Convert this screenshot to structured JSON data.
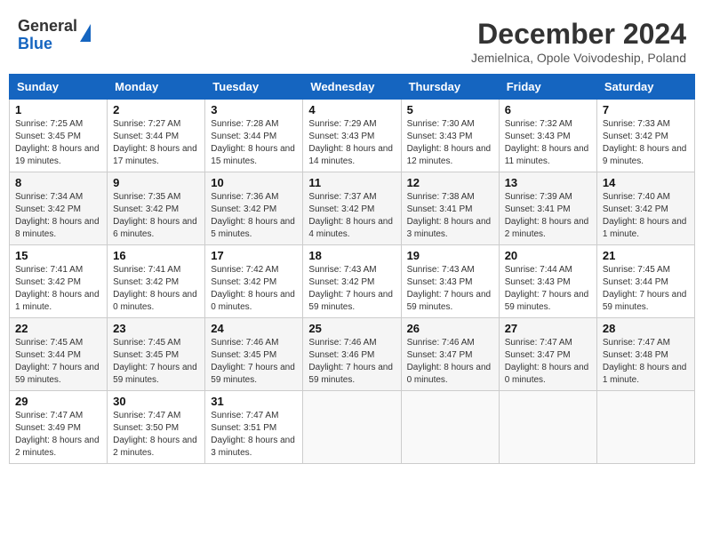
{
  "logo": {
    "general": "General",
    "blue": "Blue"
  },
  "title": "December 2024",
  "subtitle": "Jemielnica, Opole Voivodeship, Poland",
  "days_of_week": [
    "Sunday",
    "Monday",
    "Tuesday",
    "Wednesday",
    "Thursday",
    "Friday",
    "Saturday"
  ],
  "weeks": [
    [
      {
        "day": "1",
        "sunrise": "Sunrise: 7:25 AM",
        "sunset": "Sunset: 3:45 PM",
        "daylight": "Daylight: 8 hours and 19 minutes."
      },
      {
        "day": "2",
        "sunrise": "Sunrise: 7:27 AM",
        "sunset": "Sunset: 3:44 PM",
        "daylight": "Daylight: 8 hours and 17 minutes."
      },
      {
        "day": "3",
        "sunrise": "Sunrise: 7:28 AM",
        "sunset": "Sunset: 3:44 PM",
        "daylight": "Daylight: 8 hours and 15 minutes."
      },
      {
        "day": "4",
        "sunrise": "Sunrise: 7:29 AM",
        "sunset": "Sunset: 3:43 PM",
        "daylight": "Daylight: 8 hours and 14 minutes."
      },
      {
        "day": "5",
        "sunrise": "Sunrise: 7:30 AM",
        "sunset": "Sunset: 3:43 PM",
        "daylight": "Daylight: 8 hours and 12 minutes."
      },
      {
        "day": "6",
        "sunrise": "Sunrise: 7:32 AM",
        "sunset": "Sunset: 3:43 PM",
        "daylight": "Daylight: 8 hours and 11 minutes."
      },
      {
        "day": "7",
        "sunrise": "Sunrise: 7:33 AM",
        "sunset": "Sunset: 3:42 PM",
        "daylight": "Daylight: 8 hours and 9 minutes."
      }
    ],
    [
      {
        "day": "8",
        "sunrise": "Sunrise: 7:34 AM",
        "sunset": "Sunset: 3:42 PM",
        "daylight": "Daylight: 8 hours and 8 minutes."
      },
      {
        "day": "9",
        "sunrise": "Sunrise: 7:35 AM",
        "sunset": "Sunset: 3:42 PM",
        "daylight": "Daylight: 8 hours and 6 minutes."
      },
      {
        "day": "10",
        "sunrise": "Sunrise: 7:36 AM",
        "sunset": "Sunset: 3:42 PM",
        "daylight": "Daylight: 8 hours and 5 minutes."
      },
      {
        "day": "11",
        "sunrise": "Sunrise: 7:37 AM",
        "sunset": "Sunset: 3:42 PM",
        "daylight": "Daylight: 8 hours and 4 minutes."
      },
      {
        "day": "12",
        "sunrise": "Sunrise: 7:38 AM",
        "sunset": "Sunset: 3:41 PM",
        "daylight": "Daylight: 8 hours and 3 minutes."
      },
      {
        "day": "13",
        "sunrise": "Sunrise: 7:39 AM",
        "sunset": "Sunset: 3:41 PM",
        "daylight": "Daylight: 8 hours and 2 minutes."
      },
      {
        "day": "14",
        "sunrise": "Sunrise: 7:40 AM",
        "sunset": "Sunset: 3:42 PM",
        "daylight": "Daylight: 8 hours and 1 minute."
      }
    ],
    [
      {
        "day": "15",
        "sunrise": "Sunrise: 7:41 AM",
        "sunset": "Sunset: 3:42 PM",
        "daylight": "Daylight: 8 hours and 1 minute."
      },
      {
        "day": "16",
        "sunrise": "Sunrise: 7:41 AM",
        "sunset": "Sunset: 3:42 PM",
        "daylight": "Daylight: 8 hours and 0 minutes."
      },
      {
        "day": "17",
        "sunrise": "Sunrise: 7:42 AM",
        "sunset": "Sunset: 3:42 PM",
        "daylight": "Daylight: 8 hours and 0 minutes."
      },
      {
        "day": "18",
        "sunrise": "Sunrise: 7:43 AM",
        "sunset": "Sunset: 3:42 PM",
        "daylight": "Daylight: 7 hours and 59 minutes."
      },
      {
        "day": "19",
        "sunrise": "Sunrise: 7:43 AM",
        "sunset": "Sunset: 3:43 PM",
        "daylight": "Daylight: 7 hours and 59 minutes."
      },
      {
        "day": "20",
        "sunrise": "Sunrise: 7:44 AM",
        "sunset": "Sunset: 3:43 PM",
        "daylight": "Daylight: 7 hours and 59 minutes."
      },
      {
        "day": "21",
        "sunrise": "Sunrise: 7:45 AM",
        "sunset": "Sunset: 3:44 PM",
        "daylight": "Daylight: 7 hours and 59 minutes."
      }
    ],
    [
      {
        "day": "22",
        "sunrise": "Sunrise: 7:45 AM",
        "sunset": "Sunset: 3:44 PM",
        "daylight": "Daylight: 7 hours and 59 minutes."
      },
      {
        "day": "23",
        "sunrise": "Sunrise: 7:45 AM",
        "sunset": "Sunset: 3:45 PM",
        "daylight": "Daylight: 7 hours and 59 minutes."
      },
      {
        "day": "24",
        "sunrise": "Sunrise: 7:46 AM",
        "sunset": "Sunset: 3:45 PM",
        "daylight": "Daylight: 7 hours and 59 minutes."
      },
      {
        "day": "25",
        "sunrise": "Sunrise: 7:46 AM",
        "sunset": "Sunset: 3:46 PM",
        "daylight": "Daylight: 7 hours and 59 minutes."
      },
      {
        "day": "26",
        "sunrise": "Sunrise: 7:46 AM",
        "sunset": "Sunset: 3:47 PM",
        "daylight": "Daylight: 8 hours and 0 minutes."
      },
      {
        "day": "27",
        "sunrise": "Sunrise: 7:47 AM",
        "sunset": "Sunset: 3:47 PM",
        "daylight": "Daylight: 8 hours and 0 minutes."
      },
      {
        "day": "28",
        "sunrise": "Sunrise: 7:47 AM",
        "sunset": "Sunset: 3:48 PM",
        "daylight": "Daylight: 8 hours and 1 minute."
      }
    ],
    [
      {
        "day": "29",
        "sunrise": "Sunrise: 7:47 AM",
        "sunset": "Sunset: 3:49 PM",
        "daylight": "Daylight: 8 hours and 2 minutes."
      },
      {
        "day": "30",
        "sunrise": "Sunrise: 7:47 AM",
        "sunset": "Sunset: 3:50 PM",
        "daylight": "Daylight: 8 hours and 2 minutes."
      },
      {
        "day": "31",
        "sunrise": "Sunrise: 7:47 AM",
        "sunset": "Sunset: 3:51 PM",
        "daylight": "Daylight: 8 hours and 3 minutes."
      },
      null,
      null,
      null,
      null
    ]
  ]
}
